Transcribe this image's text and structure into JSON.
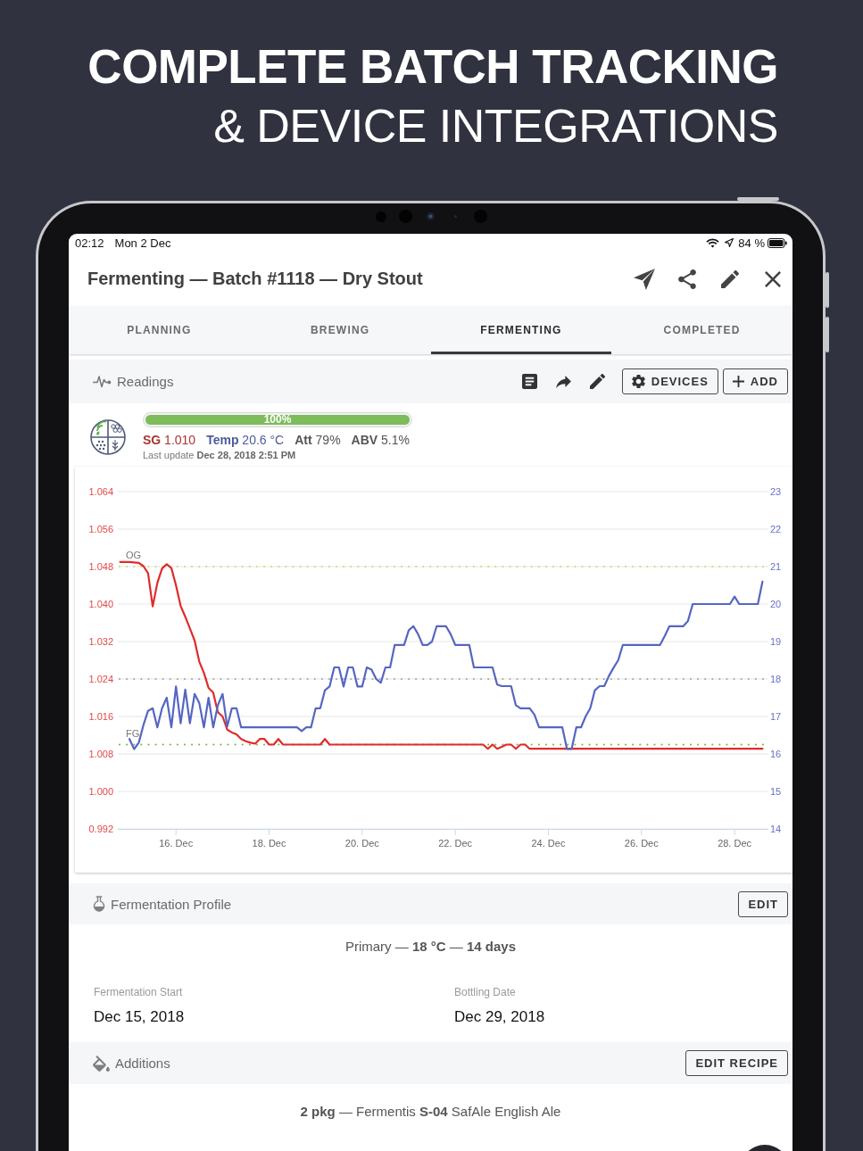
{
  "headline": {
    "title": "COMPLETE BATCH TRACKING",
    "subtitle": "& DEVICE INTEGRATIONS"
  },
  "status_bar": {
    "time": "02:12",
    "date": "Mon 2 Dec",
    "battery": "84 %"
  },
  "header": {
    "title": "Fermenting — Batch #1118 — Dry Stout"
  },
  "tabs": [
    {
      "label": "PLANNING",
      "selected": false
    },
    {
      "label": "BREWING",
      "selected": false
    },
    {
      "label": "FERMENTING",
      "selected": true
    },
    {
      "label": "COMPLETED",
      "selected": false
    }
  ],
  "readings": {
    "title": "Readings",
    "devices_button": "DEVICES",
    "add_button": "ADD",
    "progress": {
      "level": 1,
      "label": "100%"
    },
    "stats": [
      {
        "text": "**SG** 1.010",
        "color": "#a93434"
      },
      {
        "text": "**Temp** 20.6 °C",
        "color": "#4e5b9a"
      },
      {
        "text": "**Att** 79%",
        "color": "#555555"
      },
      {
        "text": "**ABV** 5.1%",
        "color": "#555555"
      }
    ],
    "last_update": "Last update **Dec 28, 2018 2:51 PM**",
    "chart_data": {
      "type": "line",
      "grid": true,
      "categories": [
        null,
        null,
        null,
        null,
        null,
        null,
        null,
        null,
        null,
        null,
        null,
        null,
        "16. Dec",
        null,
        null,
        null,
        null,
        null,
        null,
        null,
        null,
        null,
        null,
        null,
        null,
        null,
        null,
        null,
        null,
        null,
        null,
        null,
        "18. Dec",
        null,
        null,
        null,
        null,
        null,
        null,
        null,
        null,
        null,
        null,
        null,
        null,
        null,
        null,
        null,
        null,
        null,
        null,
        null,
        "20. Dec",
        null,
        null,
        null,
        null,
        null,
        null,
        null,
        null,
        null,
        null,
        null,
        null,
        null,
        null,
        null,
        null,
        null,
        null,
        null,
        "22. Dec",
        null,
        null,
        null,
        null,
        null,
        null,
        null,
        null,
        null,
        null,
        null,
        null,
        null,
        null,
        null,
        null,
        null,
        null,
        null,
        "24. Dec",
        null,
        null,
        null,
        null,
        null,
        null,
        null,
        null,
        null,
        null,
        null,
        null,
        null,
        null,
        null,
        null,
        null,
        null,
        null,
        "26. Dec",
        null,
        null,
        null,
        null,
        null,
        null,
        null,
        null,
        null,
        null,
        null,
        null,
        null,
        null,
        null,
        null,
        null,
        null,
        null,
        "28. Dec",
        null,
        null,
        null,
        null,
        null,
        null
      ],
      "ylim": [
        0.992,
        1.064
      ],
      "y2lim": [
        14,
        23
      ],
      "yticks": [
        {
          "value": 1.064,
          "label": "1.064"
        },
        {
          "value": 1.056,
          "label": "1.056"
        },
        {
          "value": 1.048,
          "label": "1.048"
        },
        {
          "value": 1.04,
          "label": "1.040"
        },
        {
          "value": 1.032,
          "label": "1.032"
        },
        {
          "value": 1.024,
          "label": "1.024"
        },
        {
          "value": 1.016,
          "label": "1.016"
        },
        {
          "value": 1.008,
          "label": "1.008"
        },
        {
          "value": 1,
          "label": "1.000"
        },
        {
          "value": 0.992,
          "label": "0.992"
        }
      ],
      "y2ticks": [
        23,
        22,
        21,
        20,
        19,
        18,
        17,
        16,
        15,
        14
      ],
      "series": [
        {
          "color": "#e02b2b",
          "values": [
            1.049,
            1.049,
            1.049,
            1.0489,
            1.0488,
            1.0481,
            1.0466,
            1.0395,
            1.0445,
            1.0476,
            1.0485,
            1.0477,
            1.044,
            1.0396,
            1.0373,
            1.0348,
            1.0322,
            1.0277,
            1.0253,
            1.0221,
            1.0211,
            1.0169,
            1.016,
            1.0132,
            1.0126,
            1.0122,
            1.0112,
            1.0107,
            1.0104,
            1.0102,
            1.0112,
            1.0112,
            1.01,
            1.01,
            1.0112,
            1.01,
            1.01,
            1.01,
            1.01,
            1.01,
            1.01,
            1.01,
            1.01,
            1.01,
            1.0112,
            1.01,
            1.01,
            1.01,
            1.01,
            1.01,
            1.01,
            1.01,
            1.01,
            1.01,
            1.01,
            1.01,
            1.01,
            1.01,
            1.01,
            1.01,
            1.01,
            1.01,
            1.01,
            1.01,
            1.01,
            1.01,
            1.01,
            1.01,
            1.01,
            1.01,
            1.01,
            1.01,
            1.01,
            1.01,
            1.01,
            1.01,
            1.01,
            1.01,
            1.01,
            1.0091,
            1.01,
            1.0091,
            1.0095,
            1.01,
            1.01,
            1.0091,
            1.01,
            1.01,
            1.0091,
            1.0091,
            1.0091,
            1.0091,
            1.0091,
            1.0091,
            1.0091,
            1.0091,
            1.0091,
            1.0091,
            1.0091,
            1.0091,
            1.0091,
            1.0091,
            1.0091,
            1.0091,
            1.0091,
            1.0091,
            1.0091,
            1.0091,
            1.0091,
            1.0091,
            1.0091,
            1.0091,
            1.0091,
            1.0091,
            1.0091,
            1.0091,
            1.0091,
            1.0091,
            1.0091,
            1.0091,
            1.0091,
            1.0091,
            1.0091,
            1.0091,
            1.0091,
            1.0091,
            1.0091,
            1.0091,
            1.0091,
            1.0091,
            1.0091,
            1.0091,
            1.0091,
            1.0091,
            1.0091,
            1.0091,
            1.0091,
            1.0091,
            1.0091
          ]
        },
        {
          "axis": "y2",
          "color": "#5566c2",
          "values": [
            null,
            null,
            16.4,
            16.13,
            16.3,
            16.77,
            17.15,
            17.22,
            16.71,
            17.22,
            17.5,
            16.71,
            17.8,
            16.82,
            17.72,
            16.82,
            17.6,
            17.36,
            16.71,
            17.5,
            16.71,
            17.3,
            17.6,
            16.73,
            17.22,
            17.22,
            16.71,
            16.71,
            16.71,
            16.71,
            16.71,
            16.71,
            16.71,
            16.71,
            16.71,
            16.71,
            16.71,
            16.71,
            16.71,
            16.61,
            16.71,
            16.71,
            17.22,
            17.22,
            17.7,
            17.8,
            18.31,
            18.31,
            17.8,
            18.31,
            18.31,
            17.8,
            17.8,
            18.31,
            18.25,
            18.0,
            17.9,
            18.31,
            18.31,
            18.91,
            18.91,
            18.91,
            19.3,
            19.41,
            19.2,
            18.91,
            18.91,
            19.0,
            19.41,
            19.41,
            19.41,
            19.2,
            18.91,
            18.91,
            18.91,
            18.91,
            18.31,
            18.31,
            18.31,
            18.31,
            18.31,
            17.85,
            17.81,
            17.81,
            17.81,
            17.3,
            17.22,
            17.22,
            17.22,
            17.05,
            16.71,
            16.71,
            16.71,
            16.71,
            16.71,
            16.71,
            16.13,
            16.13,
            16.71,
            16.71,
            17.0,
            17.22,
            17.7,
            17.81,
            17.81,
            18.08,
            18.3,
            18.5,
            18.91,
            18.91,
            18.91,
            18.91,
            18.91,
            18.91,
            18.91,
            18.91,
            18.91,
            19.15,
            19.41,
            19.41,
            19.41,
            19.41,
            19.55,
            20,
            20,
            20,
            20,
            20,
            20,
            20,
            20,
            20,
            20.2,
            20,
            20,
            20,
            20,
            20,
            20.6
          ]
        }
      ],
      "ref_lines": [
        {
          "axis": "y",
          "value": 1.048,
          "label": "OG",
          "color": "#d5d86a"
        },
        {
          "axis": "y",
          "value": 1.01,
          "label": "FG",
          "color": "#7cb342"
        },
        {
          "axis": "y2",
          "value": 18,
          "color": "#a6a6a6"
        }
      ]
    }
  },
  "fermentation_profile": {
    "title": "Fermentation Profile",
    "edit_button": "EDIT",
    "summary": "Primary — **18 °C** — **14 days**",
    "fields": [
      {
        "label": "Fermentation Start",
        "value": "Dec 15, 2018"
      },
      {
        "label": "Bottling Date",
        "value": "Dec 29, 2018"
      }
    ]
  },
  "additions": {
    "title": "Additions",
    "edit_button": "EDIT RECIPE",
    "items": [
      "**2 pkg** — Fermentis **S-04** SafAle English Ale"
    ]
  }
}
